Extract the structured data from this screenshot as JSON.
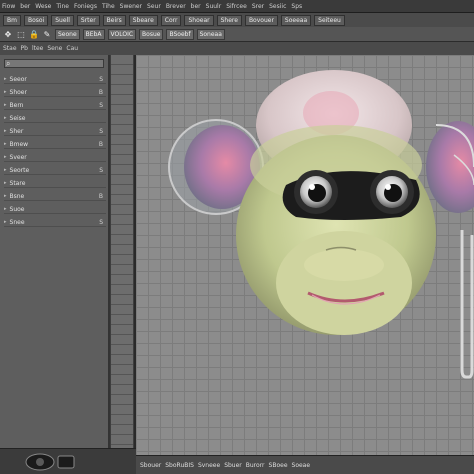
{
  "menubar": {
    "items": [
      "Fiow",
      "ber",
      "Wese",
      "Tine",
      "Foniegs",
      "Tihe",
      "Swener",
      "Seur",
      "Brever",
      "ber",
      "Suulr",
      "Sifrcee",
      "Srer",
      "Sesiic",
      "Sps"
    ]
  },
  "toolbar": {
    "buttons": [
      "Bm",
      "Bosoi",
      "Suell",
      "Srter",
      "Beirs",
      "Sbeare",
      "Corr",
      "Shoear",
      "Shere",
      "Bovouer",
      "Soeeaa",
      "Seiteeu"
    ]
  },
  "toolbar2": {
    "buttons": [
      "Seone",
      "BEbA",
      "VOLOIC",
      "Bosue",
      "BSoebf",
      "Soneaa"
    ]
  },
  "toolbar3": {
    "items": [
      "Stae",
      "Pb",
      "ltee",
      "Sene",
      "Cau"
    ]
  },
  "left_panel": {
    "search_placeholder": "",
    "rows": [
      {
        "label": "Seeor",
        "value": "S"
      },
      {
        "label": "Shoer",
        "value": "B"
      },
      {
        "label": "Bern",
        "value": "S"
      },
      {
        "label": "Seise",
        "value": ""
      },
      {
        "label": "Sher",
        "value": "S"
      },
      {
        "label": "Bmew",
        "value": "B"
      },
      {
        "label": "Sveer",
        "value": ""
      },
      {
        "label": "Seorte",
        "value": "S"
      },
      {
        "label": "Stare",
        "value": ""
      },
      {
        "label": "Bsne",
        "value": "B"
      },
      {
        "label": "Suoe",
        "value": ""
      },
      {
        "label": "Snee",
        "value": "S"
      }
    ]
  },
  "statusbar": {
    "items": [
      "Sbouer",
      "SboRuBIS",
      "Svneee",
      "Sbuer",
      "Burorr",
      "SBoee",
      "Soeae"
    ]
  },
  "colors": {
    "background": "#2a2a2a",
    "viewport": "#8c8c8c",
    "panel": "#5e5e5e",
    "head_skin": "#c9cf9a",
    "ear_pink": "#d98ab0"
  }
}
